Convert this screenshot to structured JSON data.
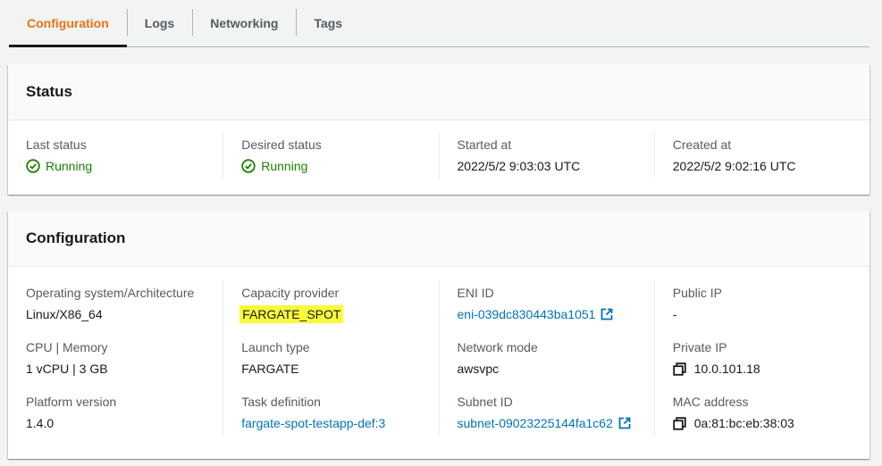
{
  "tabs": [
    {
      "label": "Configuration",
      "active": true
    },
    {
      "label": "Logs"
    },
    {
      "label": "Networking"
    },
    {
      "label": "Tags"
    }
  ],
  "status_panel": {
    "title": "Status",
    "fields": [
      {
        "label": "Last status",
        "value": "Running",
        "icon": "check-circle-icon"
      },
      {
        "label": "Desired status",
        "value": "Running",
        "icon": "check-circle-icon"
      },
      {
        "label": "Started at",
        "value": "2022/5/2 9:03:03 UTC"
      },
      {
        "label": "Created at",
        "value": "2022/5/2 9:02:16 UTC"
      }
    ]
  },
  "config_panel": {
    "title": "Configuration",
    "columns": [
      [
        {
          "label": "Operating system/Architecture",
          "value": "Linux/X86_64"
        },
        {
          "label": "CPU | Memory",
          "value": "1 vCPU | 3 GB"
        },
        {
          "label": "Platform version",
          "value": "1.4.0"
        }
      ],
      [
        {
          "label": "Capacity provider",
          "value": "FARGATE_SPOT",
          "highlight": "#fafa3c"
        },
        {
          "label": "Launch type",
          "value": "FARGATE"
        },
        {
          "label": "Task definition",
          "value": "fargate-spot-testapp-def:3"
        }
      ],
      [
        {
          "label": "ENI ID",
          "value": "eni-039dc830443ba1051",
          "icon": "external-link-icon"
        },
        {
          "label": "Network mode",
          "value": "awsvpc"
        },
        {
          "label": "Subnet ID",
          "value": "subnet-09023225144fa1c62",
          "icon": "external-link-icon"
        }
      ],
      [
        {
          "label": "Public IP",
          "value": "-"
        },
        {
          "label": "Private IP",
          "value": "10.0.101.18",
          "icon": "copy-icon"
        },
        {
          "label": "MAC address",
          "value": "0a:81:bc:eb:38:03",
          "icon": "copy-icon"
        }
      ]
    ]
  },
  "colors": {
    "accent": "#ec7211",
    "link": "#0073bb",
    "success": "#1d8102",
    "highlight": "#fafa3c"
  }
}
